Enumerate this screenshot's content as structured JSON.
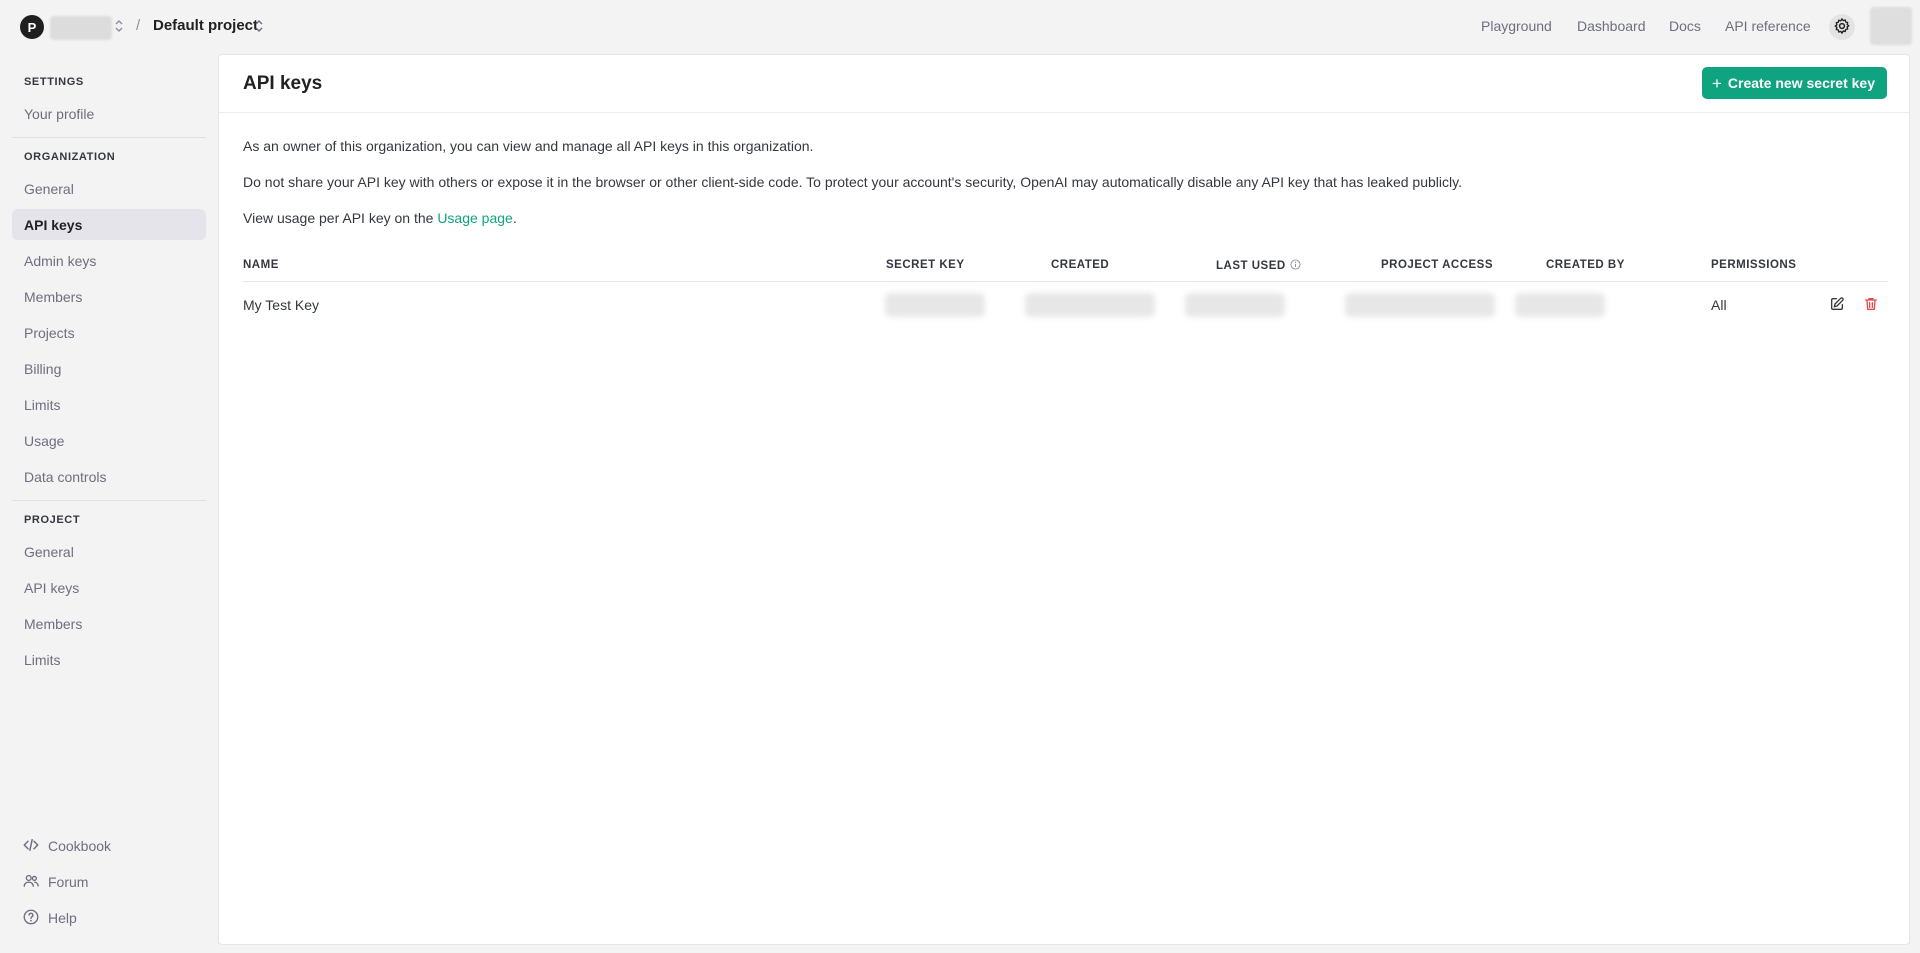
{
  "header": {
    "org_avatar_letter": "P",
    "breadcrumb_separator": "/",
    "project_name": "Default project",
    "nav": [
      "Playground",
      "Dashboard",
      "Docs",
      "API reference"
    ]
  },
  "sidebar": {
    "settings_label": "SETTINGS",
    "your_profile": "Your profile",
    "organization_label": "ORGANIZATION",
    "org_items": [
      "General",
      "API keys",
      "Admin keys",
      "Members",
      "Projects",
      "Billing",
      "Limits",
      "Usage",
      "Data controls"
    ],
    "active_item": "API keys",
    "project_label": "PROJECT",
    "project_items": [
      "General",
      "API keys",
      "Members",
      "Limits"
    ],
    "footer": [
      "Cookbook",
      "Forum",
      "Help"
    ]
  },
  "main": {
    "title": "API keys",
    "create_button": "Create new secret key",
    "para1": "As an owner of this organization, you can view and manage all API keys in this organization.",
    "para2": "Do not share your API key with others or expose it in the browser or other client-side code. To protect your account's security, OpenAI may automatically disable any API key that has leaked publicly.",
    "para3_prefix": "View usage per API key on the ",
    "para3_link": "Usage page",
    "para3_suffix": "."
  },
  "table": {
    "columns": [
      "NAME",
      "SECRET KEY",
      "CREATED",
      "LAST USED",
      "PROJECT ACCESS",
      "CREATED BY",
      "PERMISSIONS"
    ],
    "rows": [
      {
        "name": "My Test Key",
        "permissions": "All"
      }
    ]
  },
  "colors": {
    "accent": "#10a37f",
    "danger": "#e5484d"
  }
}
